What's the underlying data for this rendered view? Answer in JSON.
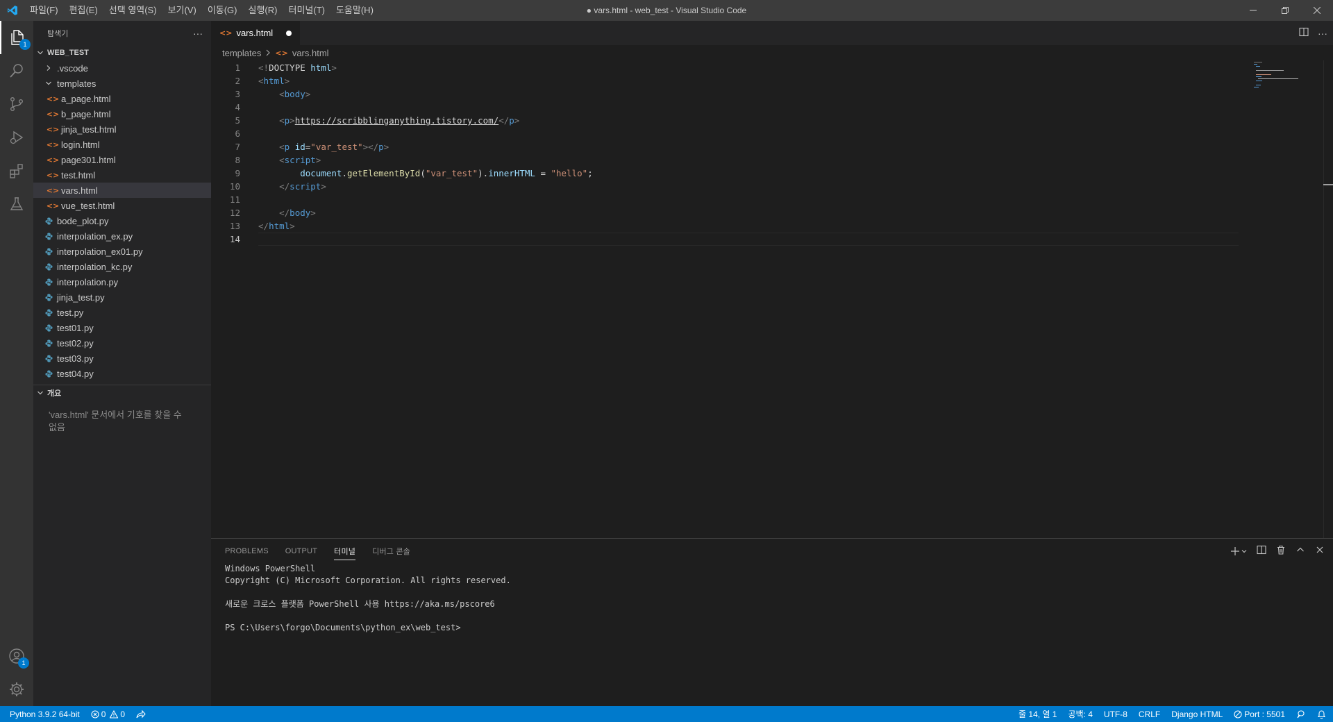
{
  "window": {
    "title": "● vars.html - web_test - Visual Studio Code",
    "menu": [
      "파일(F)",
      "편집(E)",
      "선택 영역(S)",
      "보기(V)",
      "이동(G)",
      "실행(R)",
      "터미널(T)",
      "도움말(H)"
    ]
  },
  "activity_bar": {
    "explorer_badge": "1",
    "accounts_badge": "1"
  },
  "sidebar": {
    "title": "탐색기",
    "more": "···",
    "root_folder": "WEB_TEST",
    "tree": [
      {
        "label": ".vscode",
        "kind": "folder-collapsed",
        "depth": 1
      },
      {
        "label": "templates",
        "kind": "folder-open",
        "depth": 1
      },
      {
        "label": "a_page.html",
        "kind": "html",
        "depth": 2
      },
      {
        "label": "b_page.html",
        "kind": "html",
        "depth": 2
      },
      {
        "label": "jinja_test.html",
        "kind": "html",
        "depth": 2
      },
      {
        "label": "login.html",
        "kind": "html",
        "depth": 2
      },
      {
        "label": "page301.html",
        "kind": "html",
        "depth": 2
      },
      {
        "label": "test.html",
        "kind": "html",
        "depth": 2
      },
      {
        "label": "vars.html",
        "kind": "html",
        "depth": 2,
        "selected": true
      },
      {
        "label": "vue_test.html",
        "kind": "html",
        "depth": 2
      },
      {
        "label": "bode_plot.py",
        "kind": "py",
        "depth": 1
      },
      {
        "label": "interpolation_ex.py",
        "kind": "py",
        "depth": 1
      },
      {
        "label": "interpolation_ex01.py",
        "kind": "py",
        "depth": 1
      },
      {
        "label": "interpolation_kc.py",
        "kind": "py",
        "depth": 1
      },
      {
        "label": "interpolation.py",
        "kind": "py",
        "depth": 1
      },
      {
        "label": "jinja_test.py",
        "kind": "py",
        "depth": 1
      },
      {
        "label": "test.py",
        "kind": "py",
        "depth": 1
      },
      {
        "label": "test01.py",
        "kind": "py",
        "depth": 1
      },
      {
        "label": "test02.py",
        "kind": "py",
        "depth": 1
      },
      {
        "label": "test03.py",
        "kind": "py",
        "depth": 1
      },
      {
        "label": "test04.py",
        "kind": "py",
        "depth": 1
      }
    ],
    "outline_title": "개요",
    "outline_empty": "'vars.html' 문서에서 기호를 찾을 수 없음"
  },
  "editor": {
    "tab_label": "vars.html",
    "breadcrumb": [
      "templates",
      "vars.html"
    ],
    "current_line": 14,
    "lines": [
      [
        {
          "t": "<!",
          "c": "punc"
        },
        {
          "t": "DOCTYPE",
          "c": "text"
        },
        {
          "t": " ",
          "c": "text"
        },
        {
          "t": "html",
          "c": "attr"
        },
        {
          "t": ">",
          "c": "punc"
        }
      ],
      [
        {
          "t": "<",
          "c": "punc"
        },
        {
          "t": "html",
          "c": "tag"
        },
        {
          "t": ">",
          "c": "punc"
        }
      ],
      [
        {
          "t": "    ",
          "c": "text"
        },
        {
          "t": "<",
          "c": "punc"
        },
        {
          "t": "body",
          "c": "tag"
        },
        {
          "t": ">",
          "c": "punc"
        }
      ],
      [],
      [
        {
          "t": "    ",
          "c": "text"
        },
        {
          "t": "<",
          "c": "punc"
        },
        {
          "t": "p",
          "c": "tag"
        },
        {
          "t": ">",
          "c": "punc"
        },
        {
          "t": "https://scribblinganything.tistory.com/",
          "c": "link"
        },
        {
          "t": "</",
          "c": "punc"
        },
        {
          "t": "p",
          "c": "tag"
        },
        {
          "t": ">",
          "c": "punc"
        }
      ],
      [],
      [
        {
          "t": "    ",
          "c": "text"
        },
        {
          "t": "<",
          "c": "punc"
        },
        {
          "t": "p",
          "c": "tag"
        },
        {
          "t": " ",
          "c": "text"
        },
        {
          "t": "id",
          "c": "attr"
        },
        {
          "t": "=",
          "c": "text"
        },
        {
          "t": "\"var_test\"",
          "c": "str"
        },
        {
          "t": "></",
          "c": "punc"
        },
        {
          "t": "p",
          "c": "tag"
        },
        {
          "t": ">",
          "c": "punc"
        }
      ],
      [
        {
          "t": "    ",
          "c": "text"
        },
        {
          "t": "<",
          "c": "punc"
        },
        {
          "t": "script",
          "c": "tag"
        },
        {
          "t": ">",
          "c": "punc"
        }
      ],
      [
        {
          "t": "        ",
          "c": "text"
        },
        {
          "t": "document",
          "c": "var"
        },
        {
          "t": ".",
          "c": "text"
        },
        {
          "t": "getElementById",
          "c": "fn"
        },
        {
          "t": "(",
          "c": "text"
        },
        {
          "t": "\"var_test\"",
          "c": "str"
        },
        {
          "t": ").",
          "c": "text"
        },
        {
          "t": "innerHTML",
          "c": "var"
        },
        {
          "t": " = ",
          "c": "text"
        },
        {
          "t": "\"hello\"",
          "c": "str"
        },
        {
          "t": ";",
          "c": "text"
        }
      ],
      [
        {
          "t": "    ",
          "c": "text"
        },
        {
          "t": "</",
          "c": "punc"
        },
        {
          "t": "script",
          "c": "tag"
        },
        {
          "t": ">",
          "c": "punc"
        }
      ],
      [],
      [
        {
          "t": "    ",
          "c": "text"
        },
        {
          "t": "</",
          "c": "punc"
        },
        {
          "t": "body",
          "c": "tag"
        },
        {
          "t": ">",
          "c": "punc"
        }
      ],
      [
        {
          "t": "</",
          "c": "punc"
        },
        {
          "t": "html",
          "c": "tag"
        },
        {
          "t": ">",
          "c": "punc"
        }
      ],
      []
    ]
  },
  "panel": {
    "tabs": [
      {
        "label": "PROBLEMS",
        "active": false
      },
      {
        "label": "OUTPUT",
        "active": false
      },
      {
        "label": "터미널",
        "active": true
      },
      {
        "label": "디버그 콘솔",
        "active": false
      }
    ],
    "terminal_lines": [
      "Windows PowerShell",
      "Copyright (C) Microsoft Corporation. All rights reserved.",
      "",
      "새로운 크로스 플랫폼 PowerShell 사용 https://aka.ms/pscore6",
      "",
      "PS C:\\Users\\forgo\\Documents\\python_ex\\web_test>"
    ]
  },
  "statusbar": {
    "python": "Python 3.9.2 64-bit",
    "errors": "0",
    "warnings": "0",
    "position": "줄 14, 열 1",
    "indent": "공백: 4",
    "encoding": "UTF-8",
    "eol": "CRLF",
    "language": "Django HTML",
    "port": "Port : 5501"
  },
  "colors": {
    "accent": "#007acc",
    "html_icon": "#e37933",
    "py_icon": "#519aba"
  }
}
